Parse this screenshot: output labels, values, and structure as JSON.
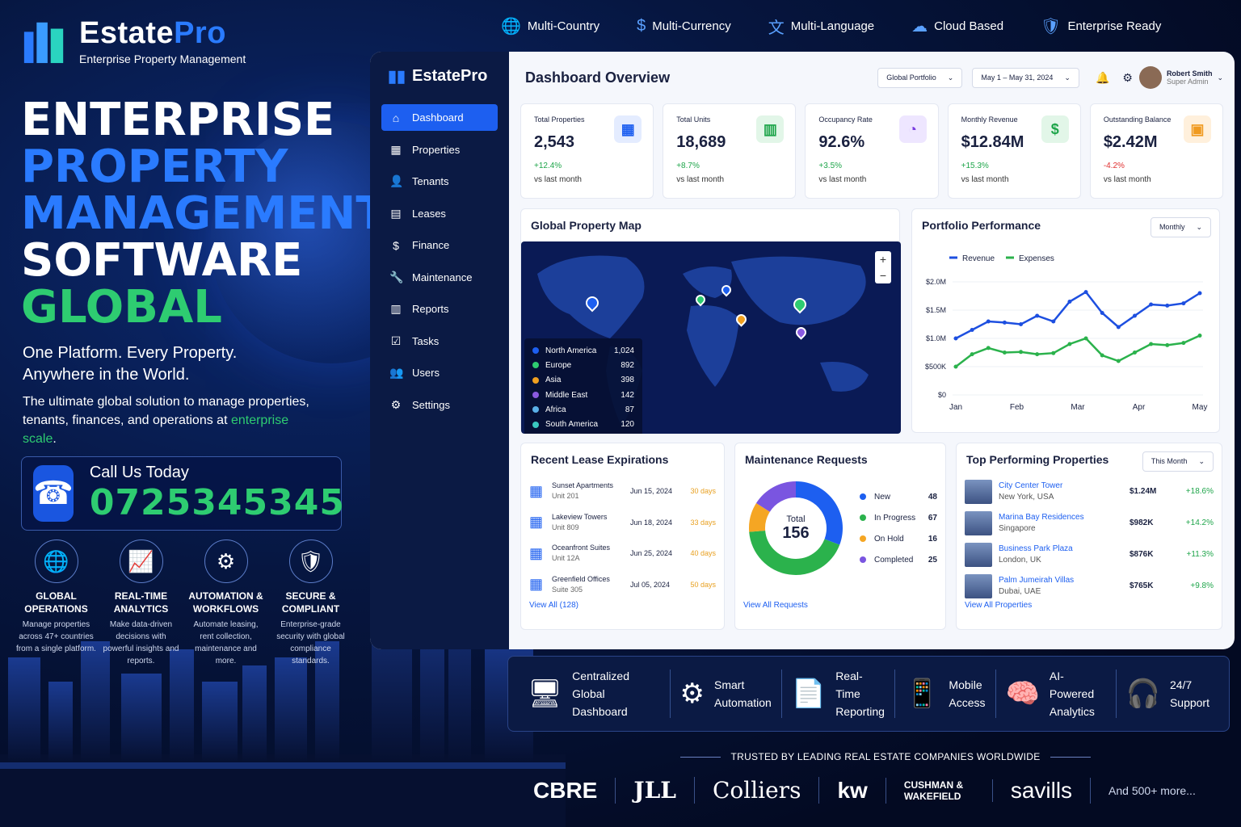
{
  "brand": {
    "name_a": "Estate",
    "name_b": "Pro",
    "sub": "Enterprise Property Management"
  },
  "hero": {
    "l1": "ENTERPRISE",
    "l2": "PROPERTY",
    "l3": "MANAGEMENT",
    "l4": "SOFTWARE",
    "l5": "GLOBAL"
  },
  "tagline": "One Platform. Every Property. Anywhere in the World.",
  "desc_pre": "The ultimate global solution to manage properties, tenants, finances, and operations at ",
  "desc_acc": "enterprise scale",
  "desc_end": ".",
  "call": {
    "label": "Call Us Today",
    "number": "0725345345"
  },
  "features": [
    {
      "icon": "globe-icon",
      "title": "GLOBAL OPERATIONS",
      "desc": "Manage properties across 47+ countries from a single platform."
    },
    {
      "icon": "chart-icon",
      "title": "REAL-TIME ANALYTICS",
      "desc": "Make data-driven decisions with powerful insights and reports."
    },
    {
      "icon": "gear-icon",
      "title": "AUTOMATION & WORKFLOWS",
      "desc": "Automate leasing, rent collection, maintenance and more."
    },
    {
      "icon": "shield-icon",
      "title": "SECURE & COMPLIANT",
      "desc": "Enterprise-grade security with global compliance standards."
    }
  ],
  "badges": [
    "Multi-Country",
    "Multi-Currency",
    "Multi-Language",
    "Cloud Based",
    "Enterprise Ready"
  ],
  "dash": {
    "brand": "EstatePro",
    "title": "Dashboard Overview",
    "portfolio": "Global Portfolio",
    "daterange": "May 1 – May 31, 2024",
    "user_name": "Robert Smith",
    "user_role": "Super Admin",
    "nav": [
      "Dashboard",
      "Properties",
      "Tenants",
      "Leases",
      "Finance",
      "Maintenance",
      "Reports",
      "Tasks",
      "Users",
      "Settings"
    ],
    "kpis": [
      {
        "label": "Total Properties",
        "value": "2,543",
        "change": "+12.4%",
        "sub": "vs last month",
        "color": "#1ea54a",
        "icon": "building-icon",
        "bg": "#e4ecff",
        "fg": "#1d5ff0"
      },
      {
        "label": "Total Units",
        "value": "18,689",
        "change": "+8.7%",
        "sub": "vs last month",
        "color": "#1ea54a",
        "icon": "units-icon",
        "bg": "#e2f6e8",
        "fg": "#1ea54a"
      },
      {
        "label": "Occupancy Rate",
        "value": "92.6%",
        "change": "+3.5%",
        "sub": "vs last month",
        "color": "#1ea54a",
        "icon": "pie-icon",
        "bg": "#eee6ff",
        "fg": "#7a3ee0"
      },
      {
        "label": "Monthly Revenue",
        "value": "$12.84M",
        "change": "+15.3%",
        "sub": "vs last month",
        "color": "#1ea54a",
        "icon": "dollar-icon",
        "bg": "#e2f6e8",
        "fg": "#1ea54a"
      },
      {
        "label": "Outstanding Balance",
        "value": "$2.42M",
        "change": "-4.2%",
        "sub": "vs last month",
        "color": "#e03030",
        "icon": "wallet-icon",
        "bg": "#fff0dc",
        "fg": "#f09a20"
      }
    ],
    "map": {
      "title": "Global Property Map",
      "regions": [
        {
          "name": "North America",
          "value": "1,024",
          "color": "#1d5ff0"
        },
        {
          "name": "Europe",
          "value": "892",
          "color": "#2ecc71"
        },
        {
          "name": "Asia",
          "value": "398",
          "color": "#f0a020"
        },
        {
          "name": "Middle East",
          "value": "142",
          "color": "#8a5ae0"
        },
        {
          "name": "Africa",
          "value": "87",
          "color": "#5ab0e8"
        },
        {
          "name": "South America",
          "value": "120",
          "color": "#3ac8c0"
        }
      ]
    },
    "perf": {
      "title": "Portfolio Performance",
      "period": "Monthly"
    },
    "leases": {
      "title": "Recent Lease Expirations",
      "link": "View All (128)",
      "items": [
        {
          "name": "Sunset Apartments",
          "unit": "Unit 201",
          "date": "Jun 15, 2024",
          "days": "30 days"
        },
        {
          "name": "Lakeview Towers",
          "unit": "Unit 809",
          "date": "Jun 18, 2024",
          "days": "33 days"
        },
        {
          "name": "Oceanfront Suites",
          "unit": "Unit 12A",
          "date": "Jun 25, 2024",
          "days": "40 days"
        },
        {
          "name": "Greenfield Offices",
          "unit": "Suite 305",
          "date": "Jul 05, 2024",
          "days": "50 days"
        }
      ]
    },
    "maint": {
      "title": "Maintenance Requests",
      "total_label": "Total",
      "total": "156",
      "link": "View All Requests",
      "items": [
        {
          "name": "New",
          "value": 48,
          "color": "#1d5ff0"
        },
        {
          "name": "In Progress",
          "value": 67,
          "color": "#2bb24c"
        },
        {
          "name": "On Hold",
          "value": 16,
          "color": "#f5a623"
        },
        {
          "name": "Completed",
          "value": 25,
          "color": "#7a55e0"
        }
      ]
    },
    "top": {
      "title": "Top Performing Properties",
      "period": "This Month",
      "link": "View All Properties",
      "items": [
        {
          "name": "City Center Tower",
          "loc": "New York, USA",
          "amt": "$1.24M",
          "ch": "+18.6%"
        },
        {
          "name": "Marina Bay Residences",
          "loc": "Singapore",
          "amt": "$982K",
          "ch": "+14.2%"
        },
        {
          "name": "Business Park Plaza",
          "loc": "London, UK",
          "amt": "$876K",
          "ch": "+11.3%"
        },
        {
          "name": "Palm Jumeirah Villas",
          "loc": "Dubai, UAE",
          "amt": "$765K",
          "ch": "+9.8%"
        }
      ]
    }
  },
  "chart_data": {
    "type": "line",
    "title": "Portfolio Performance",
    "categories": [
      "Jan",
      "",
      "Feb",
      "",
      "Mar",
      "",
      "Apr",
      "",
      "May"
    ],
    "x": [
      0,
      0.5,
      1,
      1.5,
      2,
      2.5,
      3,
      3.5,
      4
    ],
    "xticks": [
      "Jan",
      "Feb",
      "Mar",
      "Apr",
      "May"
    ],
    "series": [
      {
        "name": "Revenue",
        "color": "#1d4fe0",
        "values": [
          1.0,
          1.15,
          1.3,
          1.28,
          1.25,
          1.4,
          1.3,
          1.65,
          1.82,
          1.45,
          1.2,
          1.4,
          1.6,
          1.58,
          1.62,
          1.8
        ]
      },
      {
        "name": "Expenses",
        "color": "#2bb24c",
        "values": [
          0.5,
          0.72,
          0.83,
          0.75,
          0.76,
          0.72,
          0.74,
          0.9,
          1.0,
          0.7,
          0.6,
          0.75,
          0.9,
          0.88,
          0.92,
          1.05
        ]
      }
    ],
    "yticks": [
      "$0",
      "$500K",
      "$1.0M",
      "$1.5M",
      "$2.0M"
    ],
    "ylim": [
      0,
      2.0
    ]
  },
  "strip": [
    {
      "icon": "monitor-icon",
      "l1": "Centralized",
      "l2": "Global Dashboard"
    },
    {
      "icon": "gear-icon",
      "l1": "Smart",
      "l2": "Automation"
    },
    {
      "icon": "report-icon",
      "l1": "Real-Time",
      "l2": "Reporting"
    },
    {
      "icon": "phone-icon",
      "l1": "Mobile",
      "l2": "Access"
    },
    {
      "icon": "brain-icon",
      "l1": "AI-Powered",
      "l2": "Analytics"
    },
    {
      "icon": "headset-icon",
      "l1": "24/7",
      "l2": "Support"
    }
  ],
  "trusted": "TRUSTED BY LEADING REAL ESTATE COMPANIES WORLDWIDE",
  "logos": [
    "CBRE",
    "JLL",
    "Colliers",
    "kw",
    "CUSHMAN & WAKEFIELD",
    "savills"
  ],
  "logos_more": "And 500+ more..."
}
